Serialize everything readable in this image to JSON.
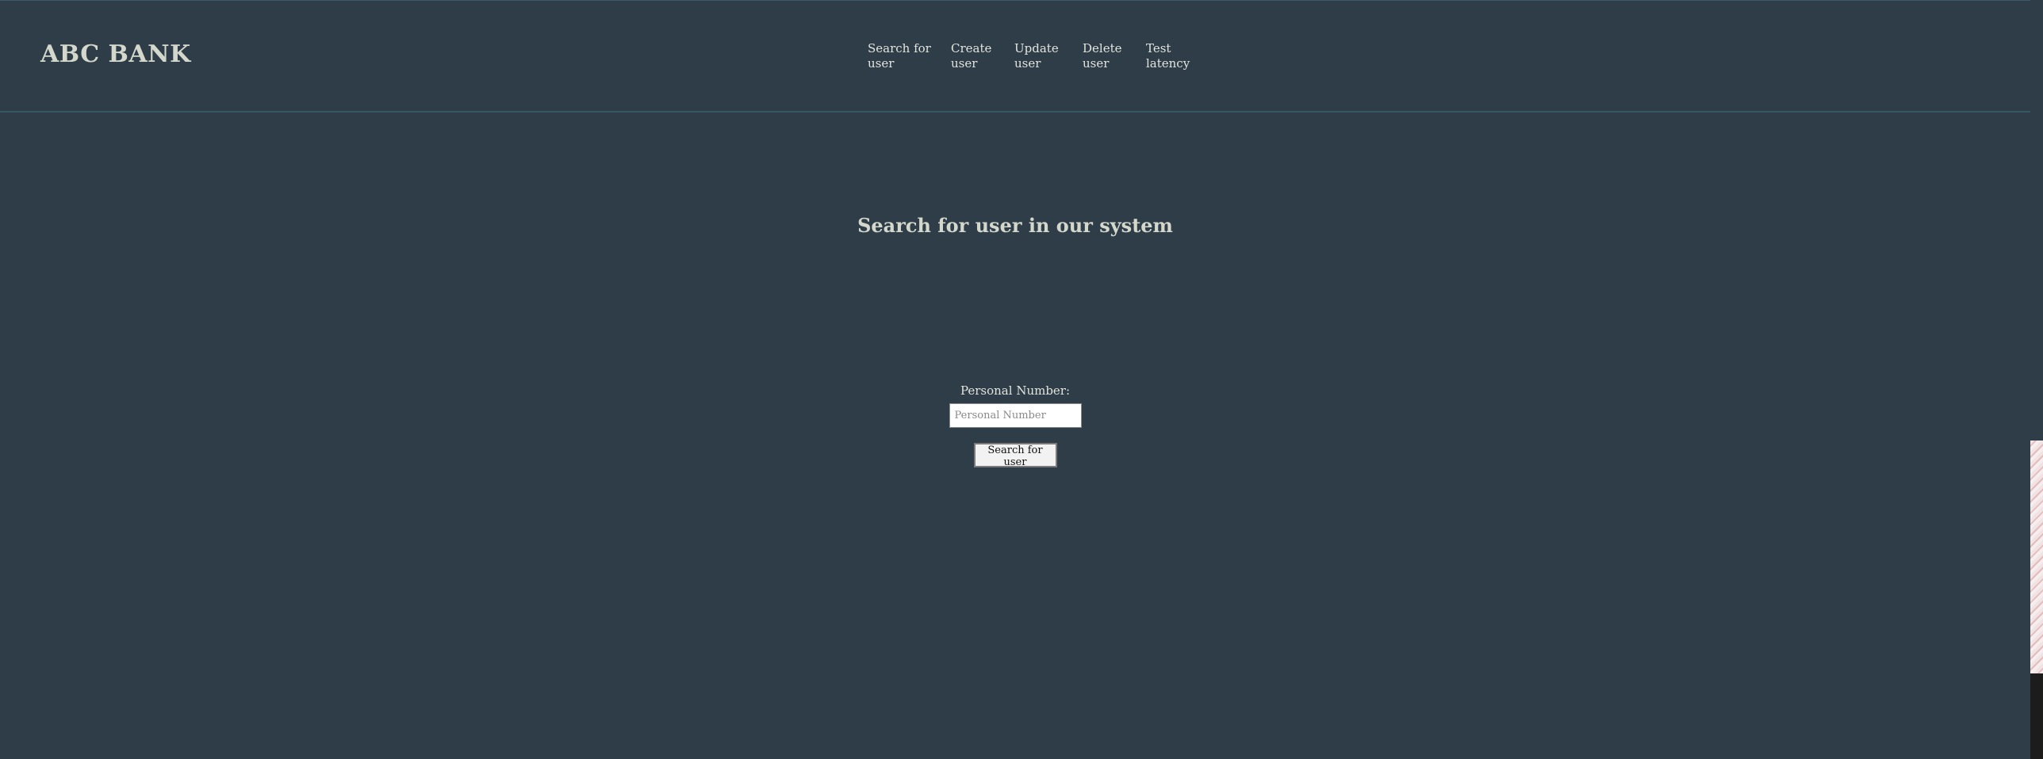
{
  "brand": {
    "name": "ABC BANK"
  },
  "nav": {
    "items": [
      {
        "line1": "Search for",
        "line2": "user"
      },
      {
        "line1": "Create",
        "line2": "user"
      },
      {
        "line1": "Update",
        "line2": "user"
      },
      {
        "line1": "Delete",
        "line2": "user"
      },
      {
        "line1": "Test",
        "line2": "latency"
      }
    ]
  },
  "main": {
    "title": "Search for user in our system",
    "form": {
      "label": "Personal Number:",
      "input_placeholder": "Personal Number",
      "input_value": "",
      "submit_label": "Search for user"
    }
  },
  "colors": {
    "background": "#2f3d48",
    "header_border": "#395660",
    "heading_text": "#d4d8cc",
    "nav_text": "#e2e4de"
  }
}
